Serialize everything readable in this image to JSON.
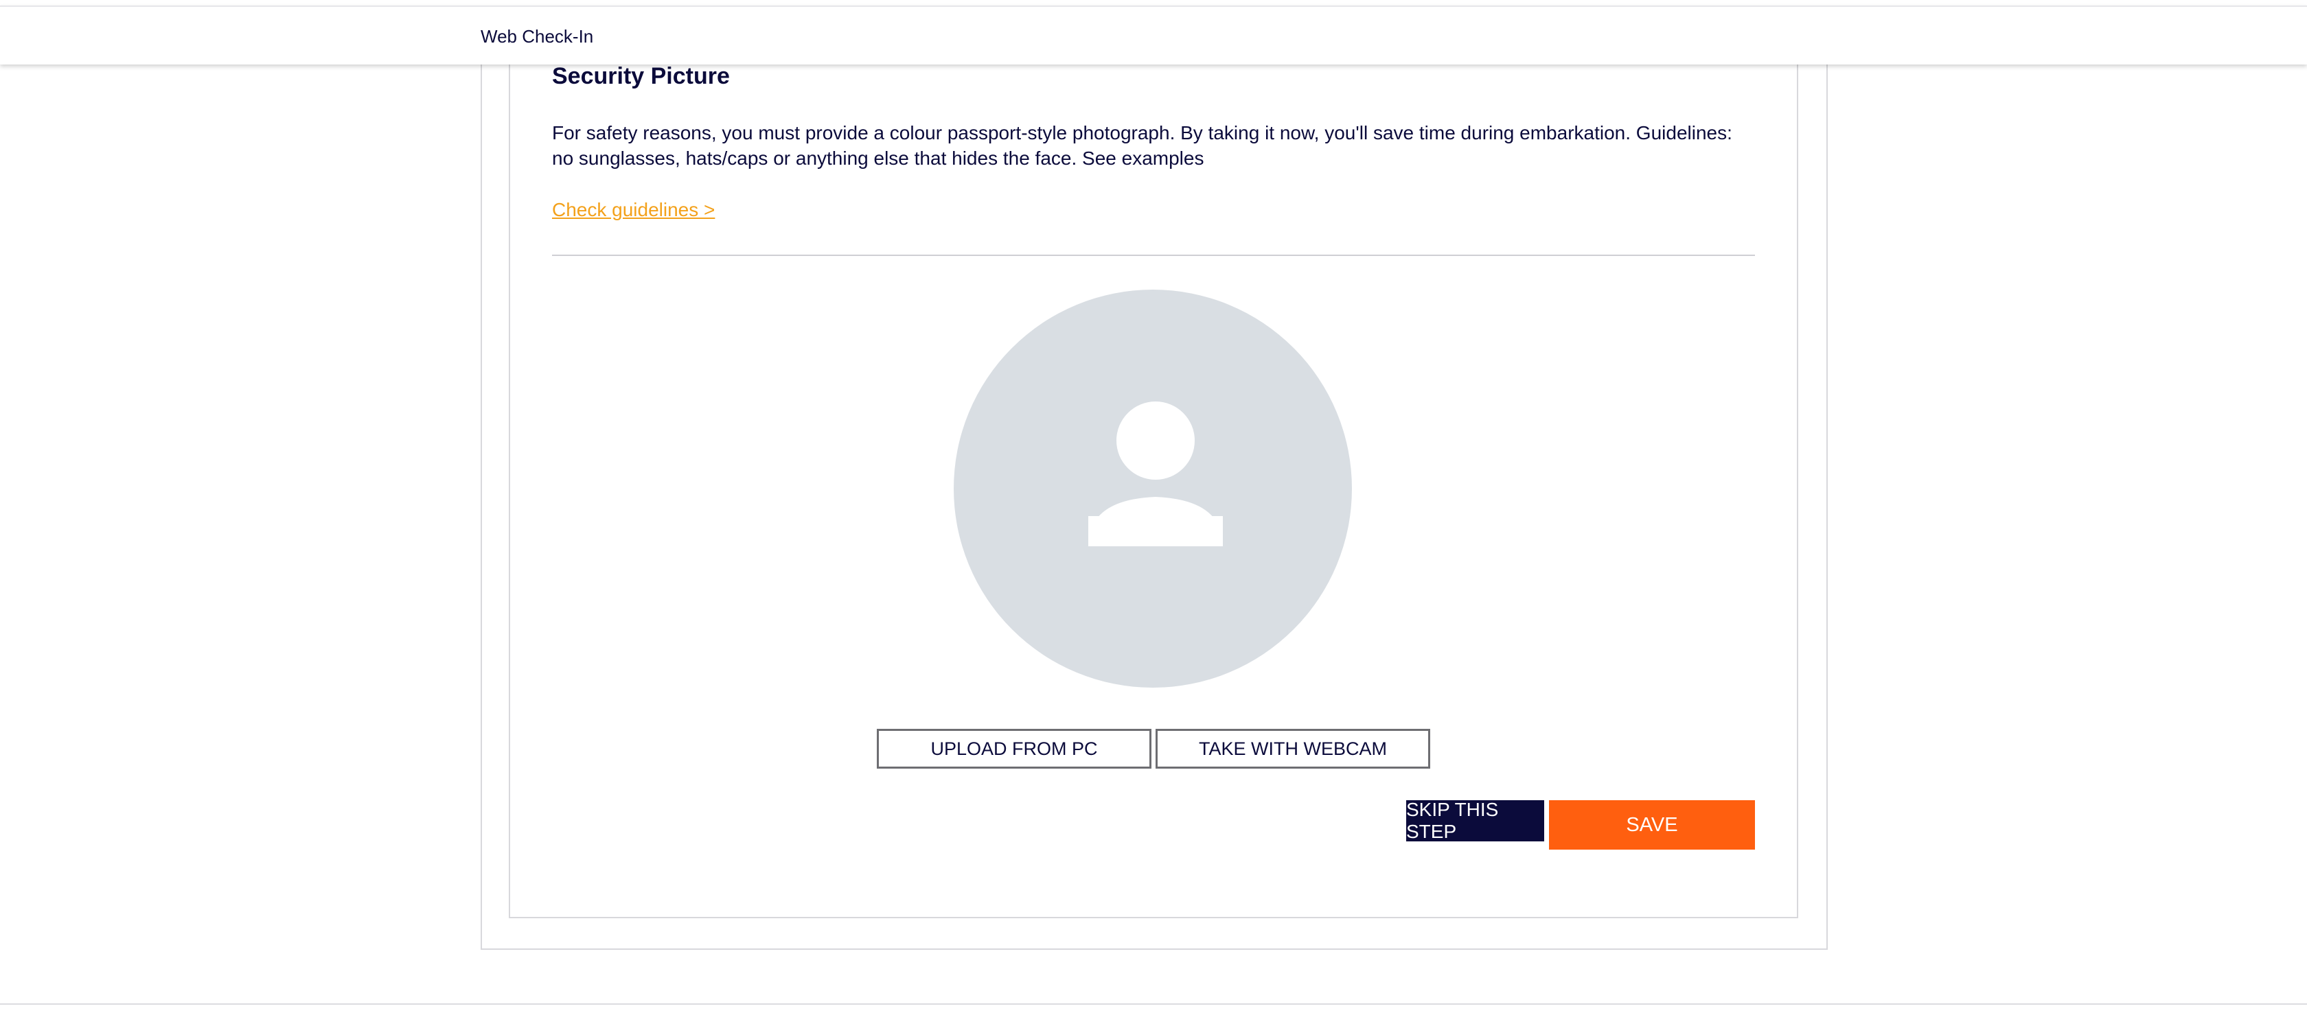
{
  "header": {
    "title": "Web Check-In"
  },
  "section": {
    "title": "Security Picture",
    "description": "For safety reasons, you must provide a colour passport-style photograph. By taking it now, you'll save time during embarkation. Guidelines: no sunglasses, hats/caps or anything else that hides the face. See examples",
    "guidelines_link": "Check guidelines >"
  },
  "avatar": {
    "icon": "user-placeholder-icon",
    "background_color": "#d9dee3"
  },
  "buttons": {
    "upload": "UPLOAD FROM PC",
    "webcam": "TAKE WITH WEBCAM",
    "skip": "SKIP THIS STEP",
    "save": "SAVE"
  },
  "colors": {
    "primary_text": "#0b0b3b",
    "link": "#f3a11b",
    "save_button": "#ff5f0f",
    "skip_button": "#0b0b3b"
  }
}
